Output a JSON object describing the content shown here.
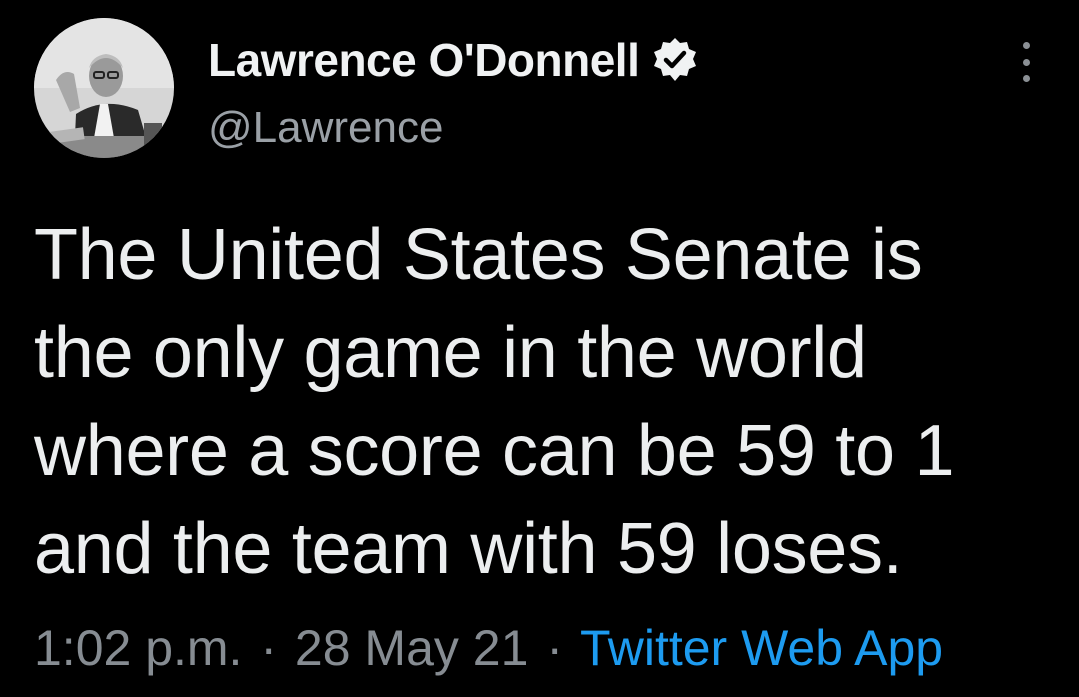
{
  "author": {
    "display_name": "Lawrence O'Donnell",
    "handle": "@Lawrence",
    "verified": true,
    "avatar": "profile-photo"
  },
  "tweet": {
    "lines": [
      "The United States Senate is",
      "the only game in the world",
      "where a score can be 59 to 1",
      "and the team with 59 loses."
    ]
  },
  "meta": {
    "time": "1:02 p.m.",
    "separator": "·",
    "date": "28 May 21",
    "source": "Twitter Web App"
  },
  "icons": {
    "verified": "verified-badge-icon",
    "more": "more-vertical-icon"
  },
  "colors": {
    "background": "#000000",
    "text": "#e7e9ea",
    "secondary": "#868c92",
    "link": "#1d9bf0"
  }
}
